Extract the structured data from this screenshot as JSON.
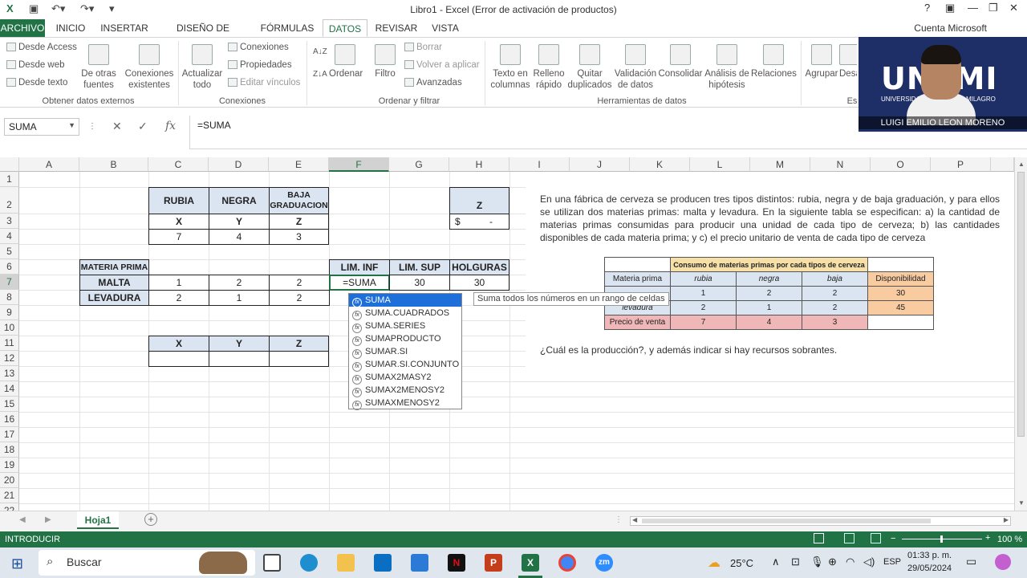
{
  "window": {
    "title": "Libro1 - Excel (Error de activación de productos)",
    "help": "?",
    "account": "Cuenta Microsoft"
  },
  "tabs": [
    "ARCHIVO",
    "INICIO",
    "INSERTAR",
    "DISEÑO DE PÁGINA",
    "FÓRMULAS",
    "DATOS",
    "REVISAR",
    "VISTA"
  ],
  "active_tab": "DATOS",
  "ribbon": {
    "external": {
      "desde_access": "Desde Access",
      "desde_web": "Desde web",
      "desde_texto": "Desde texto",
      "otras_1": "De otras",
      "otras_2": "fuentes",
      "existentes_1": "Conexiones",
      "existentes_2": "existentes",
      "group": "Obtener datos externos"
    },
    "connections": {
      "actualizar_1": "Actualizar",
      "actualizar_2": "todo",
      "conexiones": "Conexiones",
      "propiedades": "Propiedades",
      "editar": "Editar vínculos",
      "group": "Conexiones"
    },
    "sort": {
      "ordenar": "Ordenar",
      "filtro": "Filtro",
      "borrar": "Borrar",
      "volver": "Volver a aplicar",
      "avanzadas": "Avanzadas",
      "group": "Ordenar y filtrar"
    },
    "tools": {
      "texto_1": "Texto en",
      "texto_2": "columnas",
      "relleno_1": "Relleno",
      "relleno_2": "rápido",
      "quitar_1": "Quitar",
      "quitar_2": "duplicados",
      "validacion_1": "Validación",
      "validacion_2": "de datos",
      "consolidar": "Consolidar",
      "analisis_1": "Análisis de",
      "analisis_2": "hipótesis",
      "relaciones": "Relaciones",
      "group": "Herramientas de datos"
    },
    "outline": {
      "agrupar": "Agrupar",
      "desa": "Desa",
      "group": "Es"
    }
  },
  "formula_bar": {
    "name_box": "SUMA",
    "formula": "=SUMA"
  },
  "columns": [
    "A",
    "B",
    "C",
    "D",
    "E",
    "F",
    "G",
    "H",
    "I",
    "J",
    "K",
    "L",
    "M",
    "N",
    "O",
    "P"
  ],
  "selected_column": "F",
  "rows": [
    "1",
    "2",
    "3",
    "4",
    "5",
    "6",
    "7",
    "8",
    "9",
    "10",
    "11",
    "12",
    "13",
    "14",
    "15",
    "16",
    "17",
    "18",
    "19",
    "20",
    "21",
    "22"
  ],
  "selected_row": "7",
  "cells": {
    "c2": "RUBIA",
    "d2": "NEGRA",
    "e2": "BAJA GRADUACION",
    "c3": "X",
    "d3": "Y",
    "e3": "Z",
    "c4": "7",
    "d4": "4",
    "e4": "3",
    "h2": "Z",
    "h3_sym": "$",
    "h3_val": "-",
    "b6": "MATERIA PRIMA",
    "f6": "LIM. INF",
    "g6": "LIM. SUP",
    "h6": "HOLGURAS",
    "b7": "MALTA",
    "c7": "1",
    "d7": "2",
    "e7": "2",
    "f7": "=SUMA",
    "g7": "30",
    "h7": "30",
    "b8": "LEVADURA",
    "c8": "2",
    "d8": "1",
    "e8": "2",
    "c11": "X",
    "d11": "Y",
    "e11": "Z"
  },
  "problem_text": "En una fábrica de cerveza se producen tres tipos distintos: rubia, negra y de baja graduación, y para ellos se utilizan dos materias primas: malta y levadura. En la siguiente tabla se especifican: a) la cantidad de materias primas consumidas para producir una unidad de cada tipo de cerveza; b) las cantidades disponibles de cada materia prima; y c) el precio unitario de venta de cada tipo de cerveza",
  "question_text": "¿Cuál es la producción?, y además indicar si hay recursos sobrantes.",
  "image_table": {
    "header": "Consumo de materias primas por cada tipos de cerveza",
    "col_materia": "Materia prima",
    "col_rubia": "rubia",
    "col_negra": "negra",
    "col_baja": "baja",
    "col_disp": "Disponibilidad",
    "row1": [
      "",
      "1",
      "2",
      "2",
      "30"
    ],
    "row2": [
      "levadura",
      "2",
      "1",
      "2",
      "45"
    ],
    "row3": [
      "Precio de venta",
      "7",
      "4",
      "3",
      ""
    ]
  },
  "autocomplete": {
    "items": [
      "SUMA",
      "SUMA.CUADRADOS",
      "SUMA.SERIES",
      "SUMAPRODUCTO",
      "SUMAR.SI",
      "SUMAR.SI.CONJUNTO",
      "SUMAX2MASY2",
      "SUMAX2MENOSY2",
      "SUMAXMENOSY2"
    ],
    "selected": "SUMA",
    "tooltip": "Suma todos los números en un rango de celdas"
  },
  "sheet_tab": "Hoja1",
  "status": {
    "mode": "INTRODUCIR",
    "zoom": "100 %"
  },
  "taskbar": {
    "search": "Buscar",
    "weather": "25°C",
    "lang": "ESP",
    "time": "01:33 p. m.",
    "date": "29/05/2024"
  },
  "webcam": {
    "logo": "UNEMI",
    "subtitle": "UNIVERSIDAD ESTATAL DE MILAGRO",
    "name": "LUIGI EMILIO LEON MORENO"
  },
  "colors": {
    "excel_green": "#217346",
    "header_blue": "#dbe5f1",
    "select_blue": "#1e6fd9"
  }
}
